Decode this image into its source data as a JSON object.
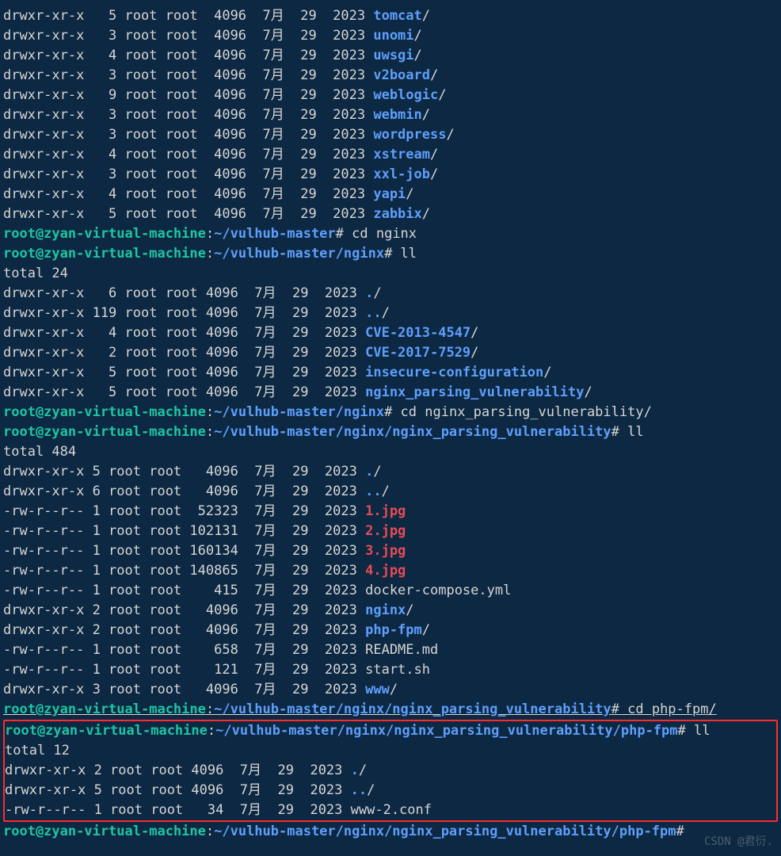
{
  "list1": [
    {
      "perm": "drwxr-xr-x",
      "n": "5",
      "o": "root",
      "g": "root",
      "sz": "4096",
      "m": "7月",
      "d": "29",
      "y": "2023",
      "name": "tomcat",
      "suffix": "/",
      "cls": "dir"
    },
    {
      "perm": "drwxr-xr-x",
      "n": "3",
      "o": "root",
      "g": "root",
      "sz": "4096",
      "m": "7月",
      "d": "29",
      "y": "2023",
      "name": "unomi",
      "suffix": "/",
      "cls": "dir"
    },
    {
      "perm": "drwxr-xr-x",
      "n": "4",
      "o": "root",
      "g": "root",
      "sz": "4096",
      "m": "7月",
      "d": "29",
      "y": "2023",
      "name": "uwsgi",
      "suffix": "/",
      "cls": "dir"
    },
    {
      "perm": "drwxr-xr-x",
      "n": "3",
      "o": "root",
      "g": "root",
      "sz": "4096",
      "m": "7月",
      "d": "29",
      "y": "2023",
      "name": "v2board",
      "suffix": "/",
      "cls": "dir"
    },
    {
      "perm": "drwxr-xr-x",
      "n": "9",
      "o": "root",
      "g": "root",
      "sz": "4096",
      "m": "7月",
      "d": "29",
      "y": "2023",
      "name": "weblogic",
      "suffix": "/",
      "cls": "dir"
    },
    {
      "perm": "drwxr-xr-x",
      "n": "3",
      "o": "root",
      "g": "root",
      "sz": "4096",
      "m": "7月",
      "d": "29",
      "y": "2023",
      "name": "webmin",
      "suffix": "/",
      "cls": "dir"
    },
    {
      "perm": "drwxr-xr-x",
      "n": "3",
      "o": "root",
      "g": "root",
      "sz": "4096",
      "m": "7月",
      "d": "29",
      "y": "2023",
      "name": "wordpress",
      "suffix": "/",
      "cls": "dir"
    },
    {
      "perm": "drwxr-xr-x",
      "n": "4",
      "o": "root",
      "g": "root",
      "sz": "4096",
      "m": "7月",
      "d": "29",
      "y": "2023",
      "name": "xstream",
      "suffix": "/",
      "cls": "dir"
    },
    {
      "perm": "drwxr-xr-x",
      "n": "3",
      "o": "root",
      "g": "root",
      "sz": "4096",
      "m": "7月",
      "d": "29",
      "y": "2023",
      "name": "xxl-job",
      "suffix": "/",
      "cls": "dir"
    },
    {
      "perm": "drwxr-xr-x",
      "n": "4",
      "o": "root",
      "g": "root",
      "sz": "4096",
      "m": "7月",
      "d": "29",
      "y": "2023",
      "name": "yapi",
      "suffix": "/",
      "cls": "dir"
    },
    {
      "perm": "drwxr-xr-x",
      "n": "5",
      "o": "root",
      "g": "root",
      "sz": "4096",
      "m": "7月",
      "d": "29",
      "y": "2023",
      "name": "zabbix",
      "suffix": "/",
      "cls": "dir"
    }
  ],
  "prompt1": {
    "user": "root@zyan-virtual-machine",
    "path": "~/vulhub-master",
    "cmd": "cd nginx"
  },
  "prompt2": {
    "user": "root@zyan-virtual-machine",
    "path": "~/vulhub-master/nginx",
    "cmd": "ll"
  },
  "total2": "total 24",
  "list2": [
    {
      "perm": "drwxr-xr-x",
      "n": "6",
      "o": "root",
      "g": "root",
      "sz": "4096",
      "m": "7月",
      "d": "29",
      "y": "2023",
      "name": ".",
      "suffix": "/",
      "cls": "dir"
    },
    {
      "perm": "drwxr-xr-x",
      "n": "119",
      "o": "root",
      "g": "root",
      "sz": "4096",
      "m": "7月",
      "d": "29",
      "y": "2023",
      "name": "..",
      "suffix": "/",
      "cls": "dir"
    },
    {
      "perm": "drwxr-xr-x",
      "n": "4",
      "o": "root",
      "g": "root",
      "sz": "4096",
      "m": "7月",
      "d": "29",
      "y": "2023",
      "name": "CVE-2013-4547",
      "suffix": "/",
      "cls": "dir"
    },
    {
      "perm": "drwxr-xr-x",
      "n": "2",
      "o": "root",
      "g": "root",
      "sz": "4096",
      "m": "7月",
      "d": "29",
      "y": "2023",
      "name": "CVE-2017-7529",
      "suffix": "/",
      "cls": "dir"
    },
    {
      "perm": "drwxr-xr-x",
      "n": "5",
      "o": "root",
      "g": "root",
      "sz": "4096",
      "m": "7月",
      "d": "29",
      "y": "2023",
      "name": "insecure-configuration",
      "suffix": "/",
      "cls": "dir"
    },
    {
      "perm": "drwxr-xr-x",
      "n": "5",
      "o": "root",
      "g": "root",
      "sz": "4096",
      "m": "7月",
      "d": "29",
      "y": "2023",
      "name": "nginx_parsing_vulnerability",
      "suffix": "/",
      "cls": "dir"
    }
  ],
  "prompt3": {
    "user": "root@zyan-virtual-machine",
    "path": "~/vulhub-master/nginx",
    "cmd": "cd nginx_parsing_vulnerability/"
  },
  "prompt4": {
    "user": "root@zyan-virtual-machine",
    "path": "~/vulhub-master/nginx/nginx_parsing_vulnerability",
    "cmd": "ll"
  },
  "total4": "total 484",
  "list3": [
    {
      "perm": "drwxr-xr-x",
      "n": "5",
      "o": "root",
      "g": "root",
      "sz": "4096",
      "m": "7月",
      "d": "29",
      "y": "2023",
      "name": ".",
      "suffix": "/",
      "cls": "dir"
    },
    {
      "perm": "drwxr-xr-x",
      "n": "6",
      "o": "root",
      "g": "root",
      "sz": "4096",
      "m": "7月",
      "d": "29",
      "y": "2023",
      "name": "..",
      "suffix": "/",
      "cls": "dir"
    },
    {
      "perm": "-rw-r--r--",
      "n": "1",
      "o": "root",
      "g": "root",
      "sz": "52323",
      "m": "7月",
      "d": "29",
      "y": "2023",
      "name": "1.jpg",
      "suffix": "",
      "cls": "img"
    },
    {
      "perm": "-rw-r--r--",
      "n": "1",
      "o": "root",
      "g": "root",
      "sz": "102131",
      "m": "7月",
      "d": "29",
      "y": "2023",
      "name": "2.jpg",
      "suffix": "",
      "cls": "img"
    },
    {
      "perm": "-rw-r--r--",
      "n": "1",
      "o": "root",
      "g": "root",
      "sz": "160134",
      "m": "7月",
      "d": "29",
      "y": "2023",
      "name": "3.jpg",
      "suffix": "",
      "cls": "img"
    },
    {
      "perm": "-rw-r--r--",
      "n": "1",
      "o": "root",
      "g": "root",
      "sz": "140865",
      "m": "7月",
      "d": "29",
      "y": "2023",
      "name": "4.jpg",
      "suffix": "",
      "cls": "img"
    },
    {
      "perm": "-rw-r--r--",
      "n": "1",
      "o": "root",
      "g": "root",
      "sz": "415",
      "m": "7月",
      "d": "29",
      "y": "2023",
      "name": "docker-compose.yml",
      "suffix": "",
      "cls": "txt"
    },
    {
      "perm": "drwxr-xr-x",
      "n": "2",
      "o": "root",
      "g": "root",
      "sz": "4096",
      "m": "7月",
      "d": "29",
      "y": "2023",
      "name": "nginx",
      "suffix": "/",
      "cls": "dir"
    },
    {
      "perm": "drwxr-xr-x",
      "n": "2",
      "o": "root",
      "g": "root",
      "sz": "4096",
      "m": "7月",
      "d": "29",
      "y": "2023",
      "name": "php-fpm",
      "suffix": "/",
      "cls": "dir"
    },
    {
      "perm": "-rw-r--r--",
      "n": "1",
      "o": "root",
      "g": "root",
      "sz": "658",
      "m": "7月",
      "d": "29",
      "y": "2023",
      "name": "README.md",
      "suffix": "",
      "cls": "txt"
    },
    {
      "perm": "-rw-r--r--",
      "n": "1",
      "o": "root",
      "g": "root",
      "sz": "121",
      "m": "7月",
      "d": "29",
      "y": "2023",
      "name": "start.sh",
      "suffix": "",
      "cls": "txt"
    },
    {
      "perm": "drwxr-xr-x",
      "n": "3",
      "o": "root",
      "g": "root",
      "sz": "4096",
      "m": "7月",
      "d": "29",
      "y": "2023",
      "name": "www",
      "suffix": "/",
      "cls": "dir"
    }
  ],
  "prompt5": {
    "user": "root@zyan-virtual-machine",
    "path": "~/vulhub-master/nginx/nginx_parsing_vulnerability",
    "cmd": "cd php-fpm/",
    "underline": true
  },
  "prompt6": {
    "user": "root@zyan-virtual-machine",
    "path": "~/vulhub-master/nginx/nginx_parsing_vulnerability/php-fpm",
    "cmd": "ll"
  },
  "total6": "total 12",
  "list4": [
    {
      "perm": "drwxr-xr-x",
      "n": "2",
      "o": "root",
      "g": "root",
      "sz": "4096",
      "m": "7月",
      "d": "29",
      "y": "2023",
      "name": ".",
      "suffix": "/",
      "cls": "dir"
    },
    {
      "perm": "drwxr-xr-x",
      "n": "5",
      "o": "root",
      "g": "root",
      "sz": "4096",
      "m": "7月",
      "d": "29",
      "y": "2023",
      "name": "..",
      "suffix": "/",
      "cls": "dir"
    },
    {
      "perm": "-rw-r--r--",
      "n": "1",
      "o": "root",
      "g": "root",
      "sz": "34",
      "m": "7月",
      "d": "29",
      "y": "2023",
      "name": "www-2.conf",
      "suffix": "",
      "cls": "txt"
    }
  ],
  "prompt7": {
    "user": "root@zyan-virtual-machine",
    "path": "~/vulhub-master/nginx/nginx_parsing_vulnerability/php-fpm",
    "cmd": ""
  },
  "watermark": "CSDN @君衍."
}
